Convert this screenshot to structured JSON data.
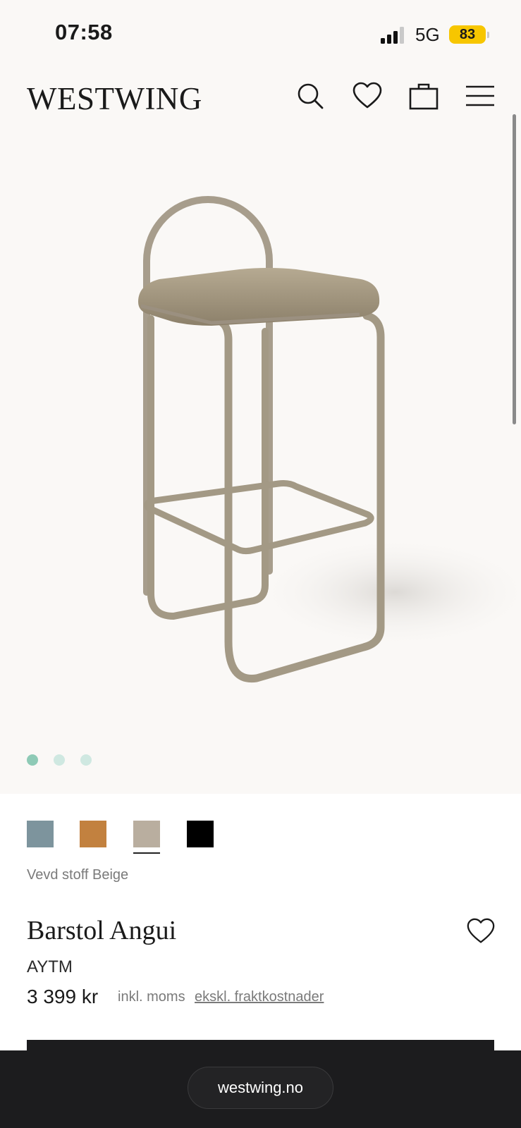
{
  "status_bar": {
    "time": "07:58",
    "network": "5G",
    "battery": "83"
  },
  "header": {
    "logo": "WESTWING",
    "icons": [
      "search-icon",
      "heart-icon",
      "bag-icon",
      "menu-icon"
    ]
  },
  "gallery": {
    "image": "barstool-product-photo",
    "dots_total": 3,
    "active_dot": 0,
    "dot_colors": {
      "active": "#8ecab6",
      "inactive": "#cfe8e1"
    }
  },
  "color_swatches": [
    {
      "color": "#7d949d",
      "selected": false
    },
    {
      "color": "#c2813f",
      "selected": false
    },
    {
      "color": "#b9ae9f",
      "selected": true
    },
    {
      "color": "#000000",
      "selected": false
    }
  ],
  "variant_label": "Vevd stoff Beige",
  "product": {
    "title": "Barstol Angui",
    "brand": "AYTM",
    "price": "3 399 kr",
    "vat_note": "inkl. moms",
    "shipping_note": "ekskl. fraktkostnader"
  },
  "browser": {
    "url": "westwing.no"
  }
}
